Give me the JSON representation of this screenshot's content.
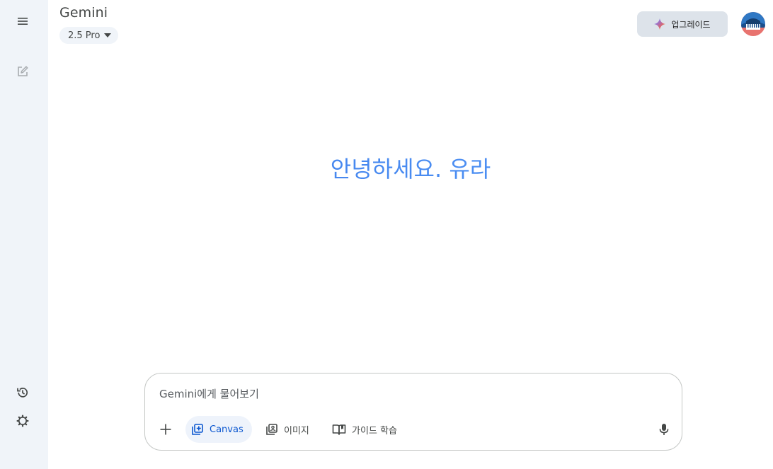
{
  "header": {
    "brand": "Gemini",
    "model_label": "2.5 Pro",
    "upgrade_label": "업그레이드"
  },
  "main": {
    "greeting": "안녕하세요. 유라"
  },
  "composer": {
    "placeholder": "Gemini에게 물어보기",
    "tools": {
      "canvas": "Canvas",
      "image": "이미지",
      "guided_learning": "가이드 학습"
    }
  },
  "sidebar": {
    "icons": [
      "menu-icon",
      "new-chat-icon",
      "history-icon",
      "settings-icon"
    ]
  },
  "colors": {
    "sidebar_bg": "#f0f4f9",
    "accent_blue": "#0b57d0",
    "greeting_blue": "#4285f4",
    "upgrade_bg": "#dde3ea"
  }
}
